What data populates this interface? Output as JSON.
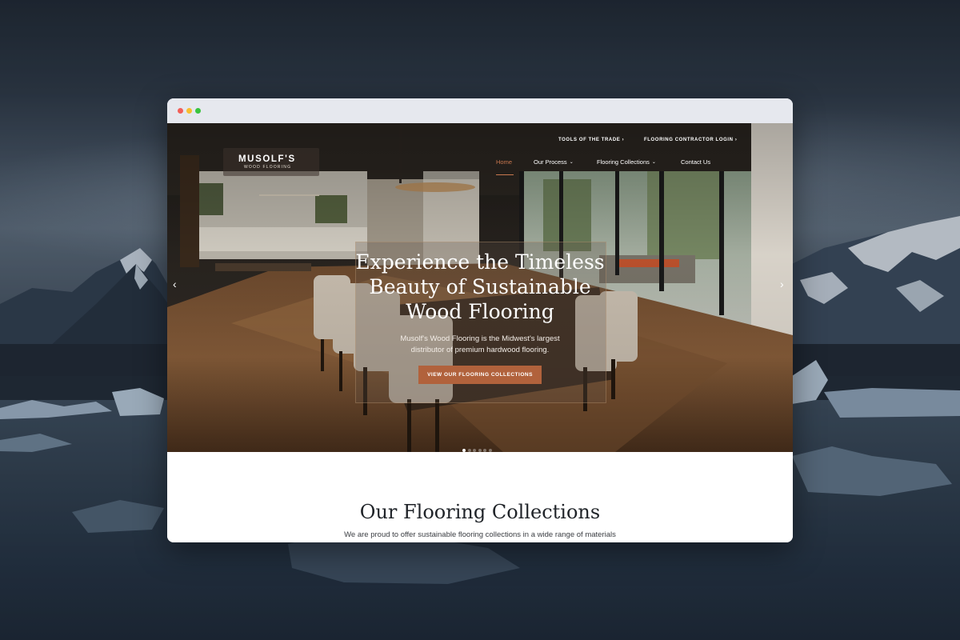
{
  "site": {
    "logo": {
      "main": "MUSOLF'S",
      "sub": "WOOD FLOORING"
    },
    "topbar": {
      "tools": "TOOLS OF THE TRADE",
      "login": "FLOORING CONTRACTOR LOGIN"
    },
    "nav": [
      {
        "label": "Home",
        "active": true
      },
      {
        "label": "Our Process",
        "has_dropdown": true
      },
      {
        "label": "Flooring Collections",
        "has_dropdown": true
      },
      {
        "label": "Contact Us"
      }
    ],
    "hero": {
      "title_lines": [
        "Experience the Timeless",
        "Beauty of Sustainable",
        "Wood Flooring"
      ],
      "subtitle_lines": [
        "Musolf's Wood Flooring is the Midwest's largest",
        "distributor of premium hardwood flooring."
      ],
      "cta": "VIEW OUR FLOORING COLLECTIONS",
      "slide_count": 6,
      "active_slide": 1
    },
    "collections": {
      "title": "Our Flooring Collections",
      "subtitle": "We are proud to offer sustainable flooring collections in a wide range of materials"
    }
  },
  "icons": {
    "topbar_chevron": "chevron-right-icon",
    "nav_chevron": "chevron-down-icon",
    "slider_prev": "chevron-left-icon",
    "slider_next": "chevron-right-icon"
  },
  "colors": {
    "accent": "#b1623c",
    "nav_active": "#c8774f",
    "browser_bar": "#e6e8ee",
    "dot_red": "#f25f58",
    "dot_yellow": "#f8be2e",
    "dot_green": "#3ac43f"
  }
}
